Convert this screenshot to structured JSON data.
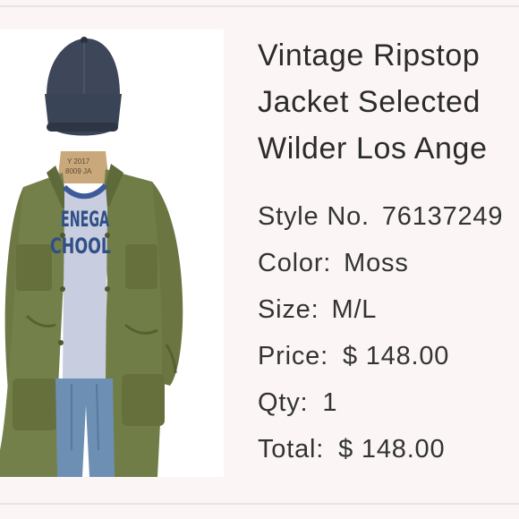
{
  "product": {
    "title_lines": [
      "Vintage Ripstop",
      "Jacket Selected",
      "Wilder Los Ange"
    ],
    "style_label": "Style No.",
    "style_value": "76137249",
    "color_label": "Color:",
    "color_value": "Moss",
    "size_label": "Size:",
    "size_value": "M/L",
    "price_label": "Price:",
    "price_value": "$ 148.00",
    "qty_label": "Qty:",
    "qty_value": "1",
    "total_label": "Total:",
    "total_value": "$ 148.00"
  },
  "photo": {
    "shirt_text_line1": "ENEGA",
    "shirt_text_line2": "CHOOL",
    "mannequin_tag_line1": "Y 2017",
    "mannequin_tag_line2": "8009 JA"
  },
  "colors": {
    "background": "#fbf6f5",
    "jacket": "#6f7a45",
    "cap": "#3c4658",
    "text": "#2b2b2b"
  }
}
